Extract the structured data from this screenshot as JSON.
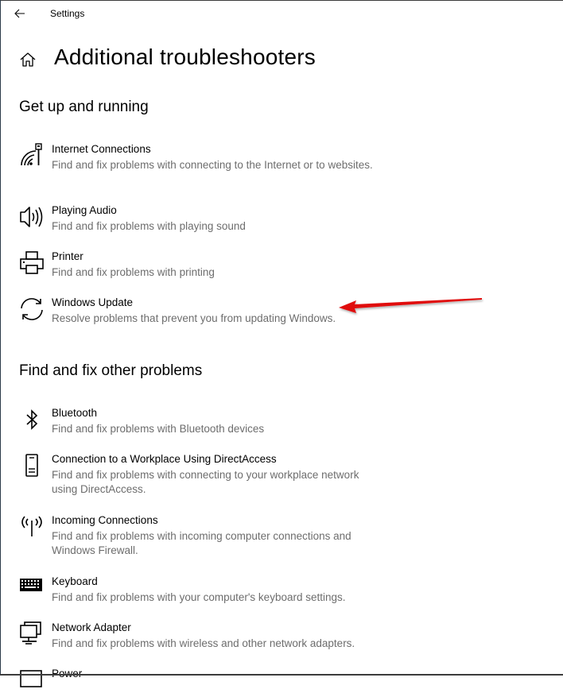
{
  "window": {
    "title": "Settings"
  },
  "header": {
    "back_icon": "arrow-left-icon",
    "home_icon": "home-icon",
    "page_title": "Additional troubleshooters"
  },
  "sections": [
    {
      "title": "Get up and running",
      "items": [
        {
          "icon": "internet-connections-icon",
          "name": "Internet Connections",
          "description": "Find and fix problems with connecting to the Internet or to websites."
        },
        {
          "icon": "speaker-icon",
          "name": "Playing Audio",
          "description": "Find and fix problems with playing sound"
        },
        {
          "icon": "printer-icon",
          "name": "Printer",
          "description": "Find and fix problems with printing"
        },
        {
          "icon": "sync-icon",
          "name": "Windows Update",
          "description": "Resolve problems that prevent you from updating Windows."
        }
      ]
    },
    {
      "title": "Find and fix other problems",
      "items": [
        {
          "icon": "bluetooth-icon",
          "name": "Bluetooth",
          "description": "Find and fix problems with Bluetooth devices"
        },
        {
          "icon": "phone-icon",
          "name": "Connection to a Workplace Using DirectAccess",
          "description": "Find and fix problems with connecting to your workplace network using DirectAccess."
        },
        {
          "icon": "antenna-icon",
          "name": "Incoming Connections",
          "description": "Find and fix problems with incoming computer connections and Windows Firewall."
        },
        {
          "icon": "keyboard-icon",
          "name": "Keyboard",
          "description": "Find and fix problems with your computer's keyboard settings."
        },
        {
          "icon": "network-adapter-icon",
          "name": "Network Adapter",
          "description": "Find and fix problems with wireless and other network adapters."
        },
        {
          "icon": "power-icon",
          "name": "Power",
          "description": ""
        }
      ]
    }
  ],
  "annotation": {
    "type": "arrow",
    "color": "#e01010",
    "points_to": "Windows Update"
  }
}
